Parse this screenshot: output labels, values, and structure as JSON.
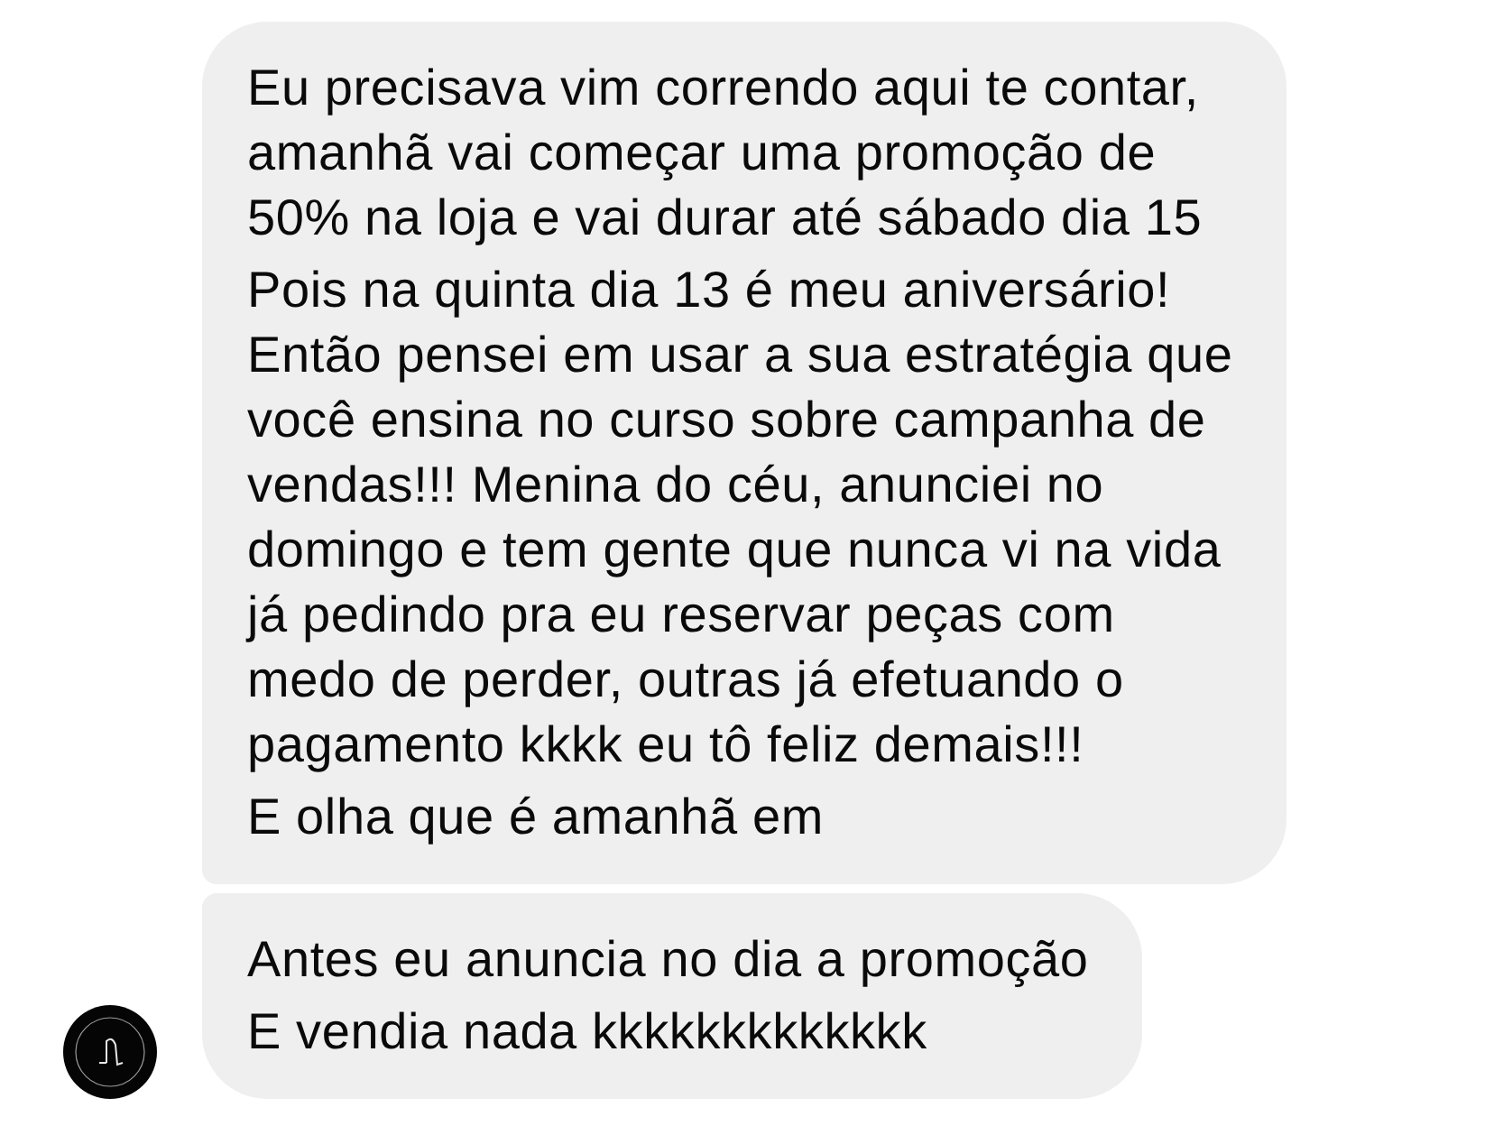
{
  "bubbles": [
    {
      "messages": [
        "Eu precisava vim correndo aqui te contar,\namanhã vai começar uma promoção de\n50% na loja e vai durar até sábado dia 15",
        "Pois na quinta dia 13 é meu aniversário!\nEntão pensei em usar a sua estratégia que\nvocê ensina no curso sobre campanha de\nvendas!!! Menina do céu, anunciei no\ndomingo e tem gente que nunca vi na vida\njá pedindo pra eu reservar peças com\nmedo de perder, outras já efetuando o\npagamento kkkk eu tô feliz demais!!!",
        "E olha que é amanhã em"
      ]
    },
    {
      "messages": [
        "Antes eu anuncia no dia a promoção",
        "E vendia nada kkkkkkkkkkkkk"
      ]
    }
  ]
}
